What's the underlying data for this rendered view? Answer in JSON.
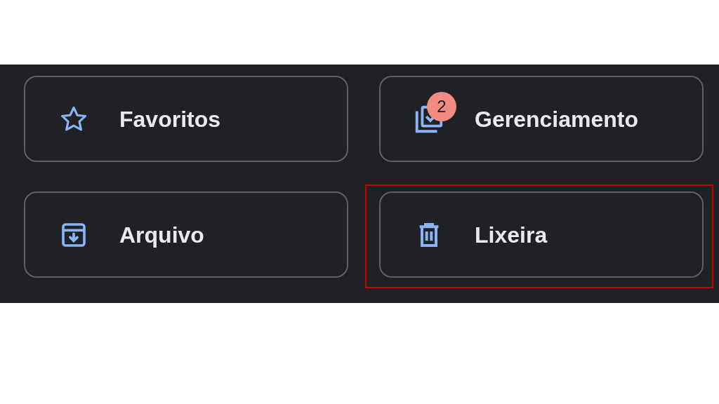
{
  "buttons": [
    {
      "label": "Favoritos",
      "kind": "star",
      "highlighted": false
    },
    {
      "label": "Gerenciamento",
      "kind": "stack-check",
      "badge": "2",
      "highlighted": false
    },
    {
      "label": "Arquivo",
      "kind": "archive",
      "highlighted": false
    },
    {
      "label": "Lixeira",
      "kind": "trash",
      "highlighted": true
    }
  ]
}
